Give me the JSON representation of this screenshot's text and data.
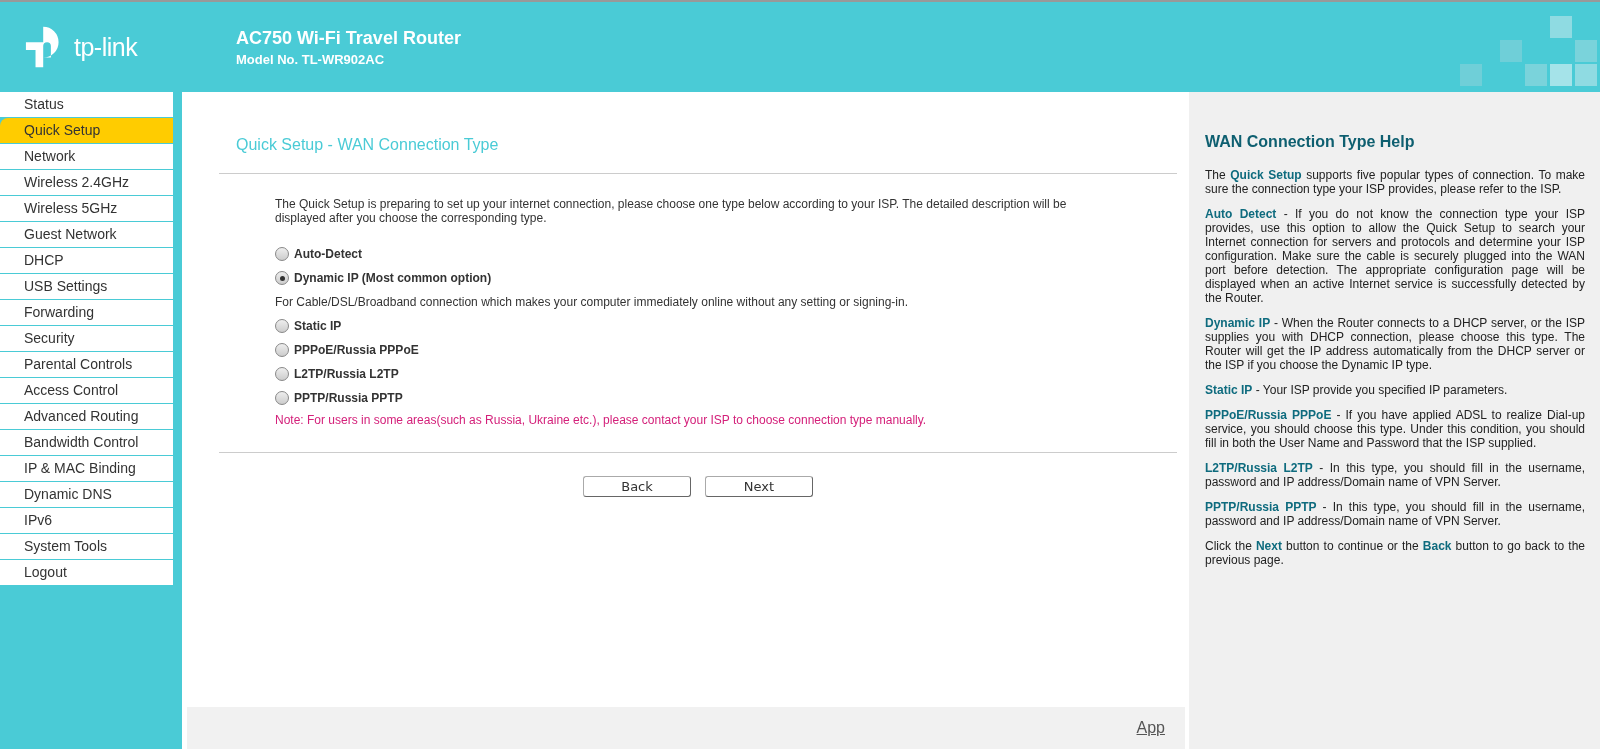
{
  "header": {
    "logo_text": "tp-link",
    "title": "AC750 Wi-Fi Travel Router",
    "model": "Model No. TL-WR902AC"
  },
  "sidebar": {
    "items": [
      {
        "label": "Status",
        "selected": false
      },
      {
        "label": "Quick Setup",
        "selected": true
      },
      {
        "label": "Network",
        "selected": false
      },
      {
        "label": "Wireless 2.4GHz",
        "selected": false
      },
      {
        "label": "Wireless 5GHz",
        "selected": false
      },
      {
        "label": "Guest Network",
        "selected": false
      },
      {
        "label": "DHCP",
        "selected": false
      },
      {
        "label": "USB Settings",
        "selected": false
      },
      {
        "label": "Forwarding",
        "selected": false
      },
      {
        "label": "Security",
        "selected": false
      },
      {
        "label": "Parental Controls",
        "selected": false
      },
      {
        "label": "Access Control",
        "selected": false
      },
      {
        "label": "Advanced Routing",
        "selected": false
      },
      {
        "label": "Bandwidth Control",
        "selected": false
      },
      {
        "label": "IP & MAC Binding",
        "selected": false
      },
      {
        "label": "Dynamic DNS",
        "selected": false
      },
      {
        "label": "IPv6",
        "selected": false
      },
      {
        "label": "System Tools",
        "selected": false
      },
      {
        "label": "Logout",
        "selected": false
      }
    ]
  },
  "main": {
    "title": "Quick Setup - WAN Connection Type",
    "intro": "The Quick Setup is preparing to set up your internet connection, please choose one type below according to your ISP. The detailed description will be displayed after you choose the corresponding type.",
    "options": [
      {
        "label": "Auto-Detect",
        "selected": false
      },
      {
        "label": "Dynamic IP (Most common option)",
        "selected": true,
        "description": "For Cable/DSL/Broadband connection which makes your computer immediately online without any setting or signing-in."
      },
      {
        "label": "Static IP",
        "selected": false
      },
      {
        "label": "PPPoE/Russia PPPoE",
        "selected": false
      },
      {
        "label": "L2TP/Russia L2TP",
        "selected": false
      },
      {
        "label": "PPTP/Russia PPTP",
        "selected": false
      }
    ],
    "note": "Note: For users in some areas(such as Russia, Ukraine etc.), please contact your ISP to choose connection type manually.",
    "buttons": [
      "Back",
      "Next"
    ],
    "footer_link": "App"
  },
  "help": {
    "title": "WAN Connection Type Help",
    "paragraphs": [
      "The **Quick Setup** supports five popular types of connection. To make sure the connection type your ISP provides, please refer to the ISP.",
      "**Auto Detect** - If you do not know the connection type your ISP provides, use this option to allow the Quick Setup to search your Internet connection for servers and protocols and determine your ISP configuration. Make sure the cable is securely plugged into the WAN port before detection. The appropriate configuration page will be displayed when an active Internet service is successfully detected by the Router.",
      "**Dynamic IP** - When the Router connects to a DHCP server, or the ISP supplies you with DHCP connection, please choose this type. The Router will get the IP address automatically from the DHCP server or the ISP if you choose the Dynamic IP type.",
      "**Static IP** - Your ISP provide you specified IP parameters.",
      "**PPPoE/Russia PPPoE** - If you have applied ADSL to realize Dial-up service, you should choose this type. Under this condition, you should fill in both the User Name and Password that the ISP supplied.",
      "**L2TP/Russia L2TP** - In this type, you should fill in the username, password and IP address/Domain name of VPN Server.",
      "**PPTP/Russia PPTP** - In this type, you should fill in the username, password and IP address/Domain name of VPN Server.",
      "Click the **Next** button to continue or the **Back** button to go back to the previous page."
    ]
  }
}
